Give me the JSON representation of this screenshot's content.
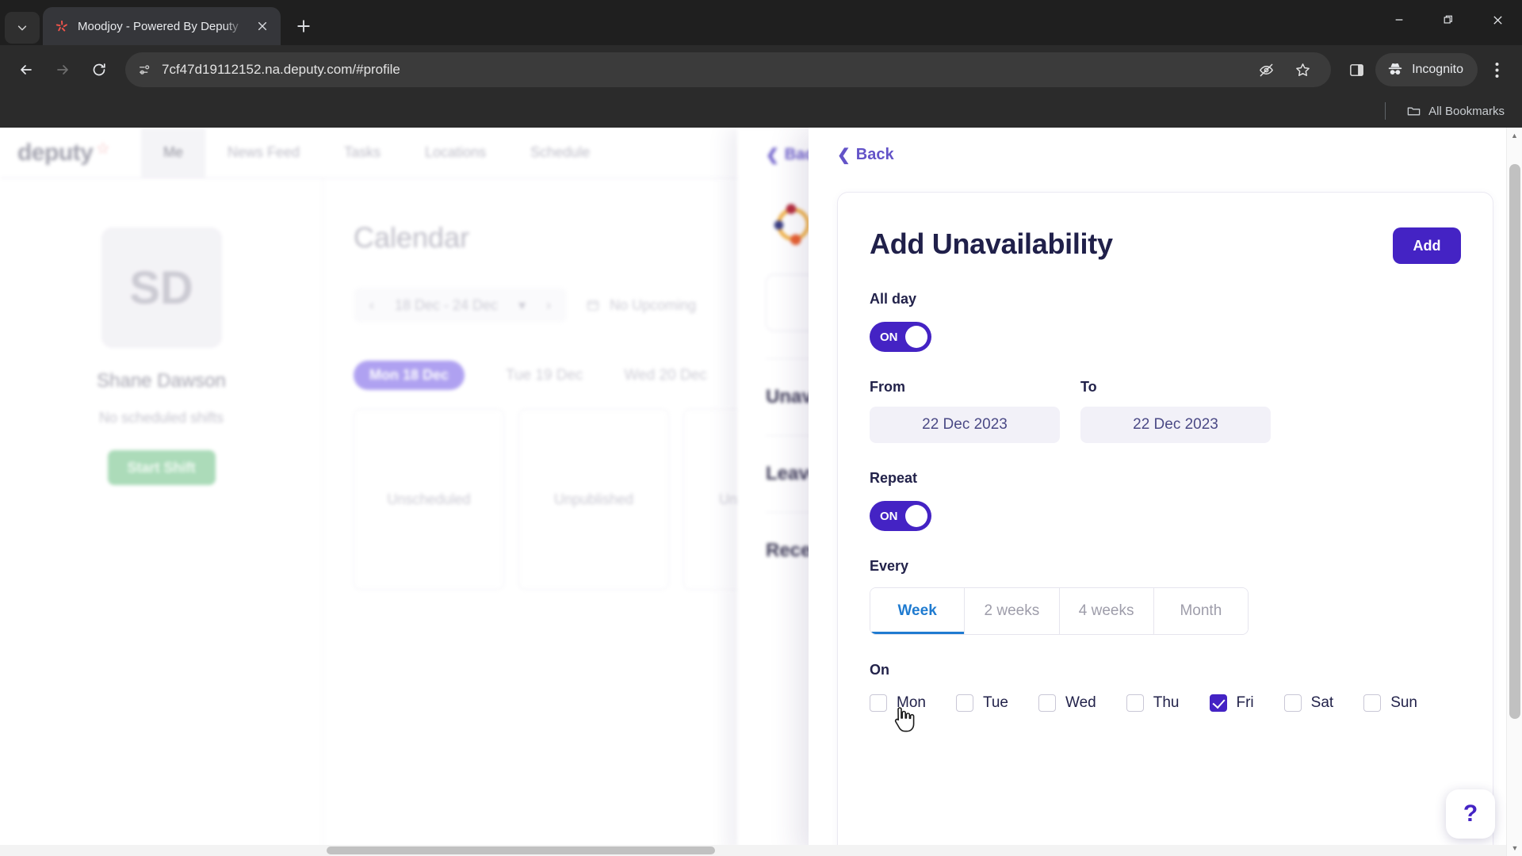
{
  "browser": {
    "tab": {
      "title": "Moodjoy - Powered By Deputy",
      "favicon_icon": "deputy-asterisk-icon",
      "close_icon": "close-icon"
    },
    "tab_list_chevron_icon": "chevron-down-icon",
    "new_tab_icon": "plus-icon",
    "window": {
      "minimize_icon": "minimize-icon",
      "maximize_icon": "restore-icon",
      "close_icon": "window-close-icon"
    },
    "nav": {
      "back_icon": "arrow-left-icon",
      "forward_icon": "arrow-right-icon",
      "reload_icon": "reload-icon"
    },
    "omnibox": {
      "site_info_icon": "site-settings-icon",
      "url": "7cf47d19112152.na.deputy.com/#profile"
    },
    "toolbar": {
      "tracking_protection_icon": "eye-slash-icon",
      "bookmark_icon": "star-icon",
      "side_panel_icon": "side-panel-icon",
      "incognito_icon": "incognito-hat-icon",
      "incognito_label": "Incognito",
      "menu_icon": "three-dot-menu-icon"
    },
    "bookmarks": {
      "folder_icon": "folder-icon",
      "all_bookmarks_label": "All Bookmarks"
    }
  },
  "app": {
    "brand": "deputy",
    "brand_icon": "deputy-asterisk-icon",
    "nav_items": [
      {
        "label": "Me",
        "active": true
      },
      {
        "label": "News Feed",
        "active": false
      },
      {
        "label": "Tasks",
        "active": false
      },
      {
        "label": "Locations",
        "active": false
      },
      {
        "label": "Schedule",
        "active": false
      }
    ],
    "profile": {
      "initials": "SD",
      "name": "Shane Dawson",
      "shift_status": "No scheduled shifts",
      "start_shift_label": "Start Shift"
    },
    "calendar": {
      "title": "Calendar",
      "prev_icon": "chevron-left-icon",
      "next_icon": "chevron-right-icon",
      "week_range": "18 Dec - 24 Dec",
      "week_caret_icon": "caret-down-icon",
      "upcoming_icon": "calendar-icon",
      "upcoming_label": "No Upcoming",
      "days": [
        {
          "label": "Mon 18 Dec",
          "selected": true,
          "card": "Unscheduled"
        },
        {
          "label": "Tue 19 Dec",
          "selected": false,
          "card": "Unpublished"
        },
        {
          "label": "Wed 20 Dec",
          "selected": false,
          "card": "Unpublished"
        }
      ]
    }
  },
  "mid_panel": {
    "back_label": "Back",
    "back_icon": "chevron-left-icon",
    "sections": [
      "Unavailability",
      "Leave",
      "Recent"
    ]
  },
  "modal": {
    "back_label": "Back",
    "back_icon": "chevron-left-icon",
    "title": "Add Unavailability",
    "add_button_label": "Add",
    "all_day": {
      "label": "All day",
      "toggle_state": "ON"
    },
    "from": {
      "label": "From",
      "value": "22 Dec 2023"
    },
    "to": {
      "label": "To",
      "value": "22 Dec 2023"
    },
    "repeat": {
      "label": "Repeat",
      "toggle_state": "ON"
    },
    "every": {
      "label": "Every",
      "options": [
        {
          "label": "Week",
          "selected": true
        },
        {
          "label": "2 weeks",
          "selected": false
        },
        {
          "label": "4 weeks",
          "selected": false
        },
        {
          "label": "Month",
          "selected": false
        }
      ]
    },
    "on": {
      "label": "On",
      "days": [
        {
          "label": "Mon",
          "checked": false
        },
        {
          "label": "Tue",
          "checked": false
        },
        {
          "label": "Wed",
          "checked": false
        },
        {
          "label": "Thu",
          "checked": false
        },
        {
          "label": "Fri",
          "checked": true
        },
        {
          "label": "Sat",
          "checked": false
        },
        {
          "label": "Sun",
          "checked": false
        }
      ]
    }
  },
  "help_button": {
    "label": "?"
  },
  "colors": {
    "primary": "#4423c4",
    "pill": "#a99af0",
    "accent_blue": "#1f7bd0",
    "green": "#a5d9b4",
    "chrome_dark": "#2b2b2b"
  }
}
